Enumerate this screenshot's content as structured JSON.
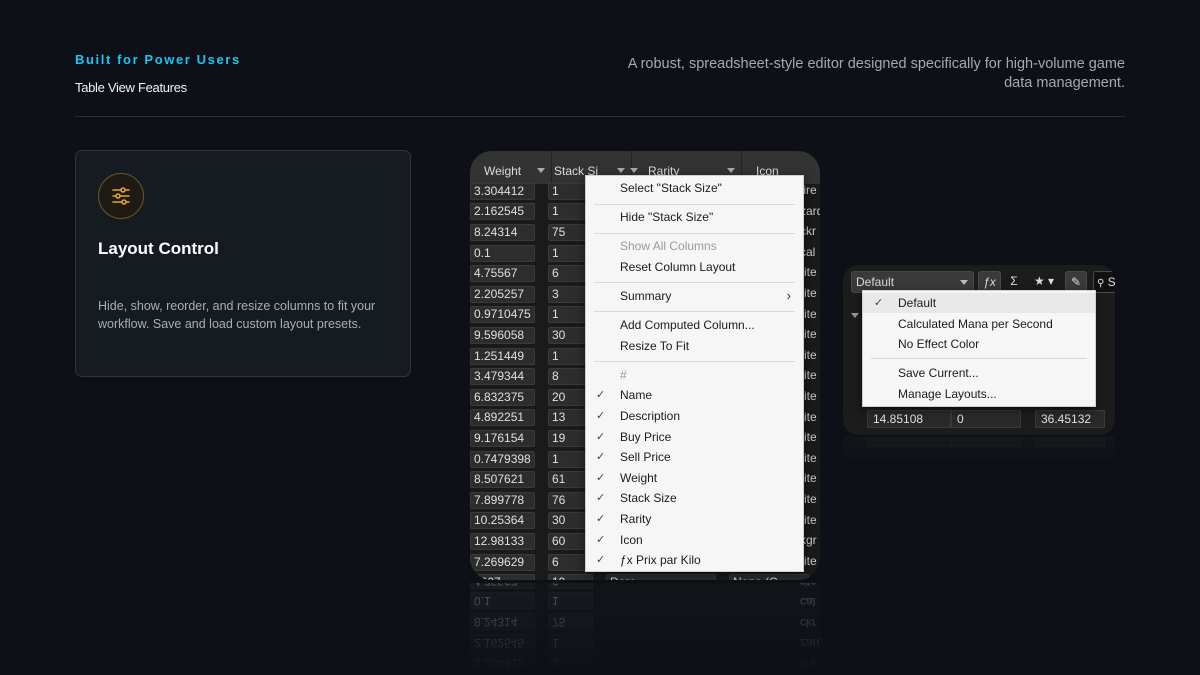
{
  "header": {
    "kicker": "Built for Power Users",
    "subtitle": "Table View Features",
    "description": "A robust, spreadsheet-style editor designed specifically for high-volume game data management."
  },
  "feature_card": {
    "icon": "sliders-icon",
    "title": "Layout Control",
    "text": "Hide, show, reorder, and resize columns to fit your workflow. Save and load custom layout presets."
  },
  "table": {
    "columns": [
      "Weight",
      "Stack Si",
      "Rarity",
      "Icon"
    ],
    "rows": [
      [
        "3.304412",
        "1",
        "fire"
      ],
      [
        "2.162545",
        "1",
        "zard"
      ],
      [
        "8.24314",
        "75",
        "ckr"
      ],
      [
        "0.1",
        "1",
        "cal"
      ],
      [
        "4.75567",
        "6",
        "rite"
      ],
      [
        "2.205257",
        "3",
        "rite"
      ],
      [
        "0.9710475",
        "1",
        "rite"
      ],
      [
        "9.596058",
        "30",
        "rite"
      ],
      [
        "1.251449",
        "1",
        "rite"
      ],
      [
        "3.479344",
        "8",
        "rite"
      ],
      [
        "6.832375",
        "20",
        "rite"
      ],
      [
        "4.892251",
        "13",
        "rite"
      ],
      [
        "9.176154",
        "19",
        "rite"
      ],
      [
        "0.7479398",
        "1",
        "rite"
      ],
      [
        "8.507621",
        "61",
        "rite"
      ],
      [
        "7.899778",
        "76",
        "rite"
      ],
      [
        "10.25364",
        "30",
        "rite"
      ],
      [
        "12.98133",
        "60",
        "kgr"
      ],
      [
        "7.269629",
        "6",
        "rite"
      ]
    ],
    "partial_row": [
      "7007",
      "19",
      "Dore",
      "None (C"
    ]
  },
  "column_menu": {
    "items": [
      {
        "label": "Select \"Stack Size\"",
        "checked": false,
        "disabled": false
      },
      {
        "label": "Hide \"Stack Size\"",
        "checked": false,
        "disabled": false
      },
      {
        "label": "Show All Columns",
        "checked": false,
        "disabled": true
      },
      {
        "label": "Reset Column Layout",
        "checked": false,
        "disabled": false
      },
      {
        "label": "Summary",
        "checked": false,
        "disabled": false,
        "submenu": true
      },
      {
        "label": "Add Computed Column...",
        "checked": false,
        "disabled": false
      },
      {
        "label": "Resize To Fit",
        "checked": false,
        "disabled": false
      },
      {
        "label": "#",
        "checked": false,
        "disabled": true
      },
      {
        "label": "Name",
        "checked": true,
        "disabled": false
      },
      {
        "label": "Description",
        "checked": true,
        "disabled": false
      },
      {
        "label": "Buy Price",
        "checked": true,
        "disabled": false
      },
      {
        "label": "Sell Price",
        "checked": true,
        "disabled": false
      },
      {
        "label": "Weight",
        "checked": true,
        "disabled": false
      },
      {
        "label": "Stack Size",
        "checked": true,
        "disabled": false
      },
      {
        "label": "Rarity",
        "checked": true,
        "disabled": false
      },
      {
        "label": "Icon",
        "checked": true,
        "disabled": false
      },
      {
        "label": "ƒx Prix par Kilo",
        "checked": true,
        "disabled": false
      }
    ],
    "submenu_arrow": "›",
    "check_glyph": "✓"
  },
  "layout_toolbar": {
    "preset_value": "Default",
    "fx_label": "ƒx",
    "sigma_label": "Σ",
    "star_label": "★",
    "search_label": "S"
  },
  "layout_menu": {
    "items": [
      {
        "label": "Default",
        "checked": true
      },
      {
        "label": "Calculated Mana per Second",
        "checked": false
      },
      {
        "label": "No Effect Color",
        "checked": false
      },
      {
        "label": "Save Current...",
        "checked": false
      },
      {
        "label": "Manage Layouts...",
        "checked": false
      }
    ]
  },
  "layout_row": [
    "14.85108",
    "0",
    "36.45132"
  ],
  "colors": {
    "background": "#0d1117",
    "accent_cyan": "#22c3ee",
    "icon_gold": "#e0a431",
    "card_bg": "#161b22"
  }
}
